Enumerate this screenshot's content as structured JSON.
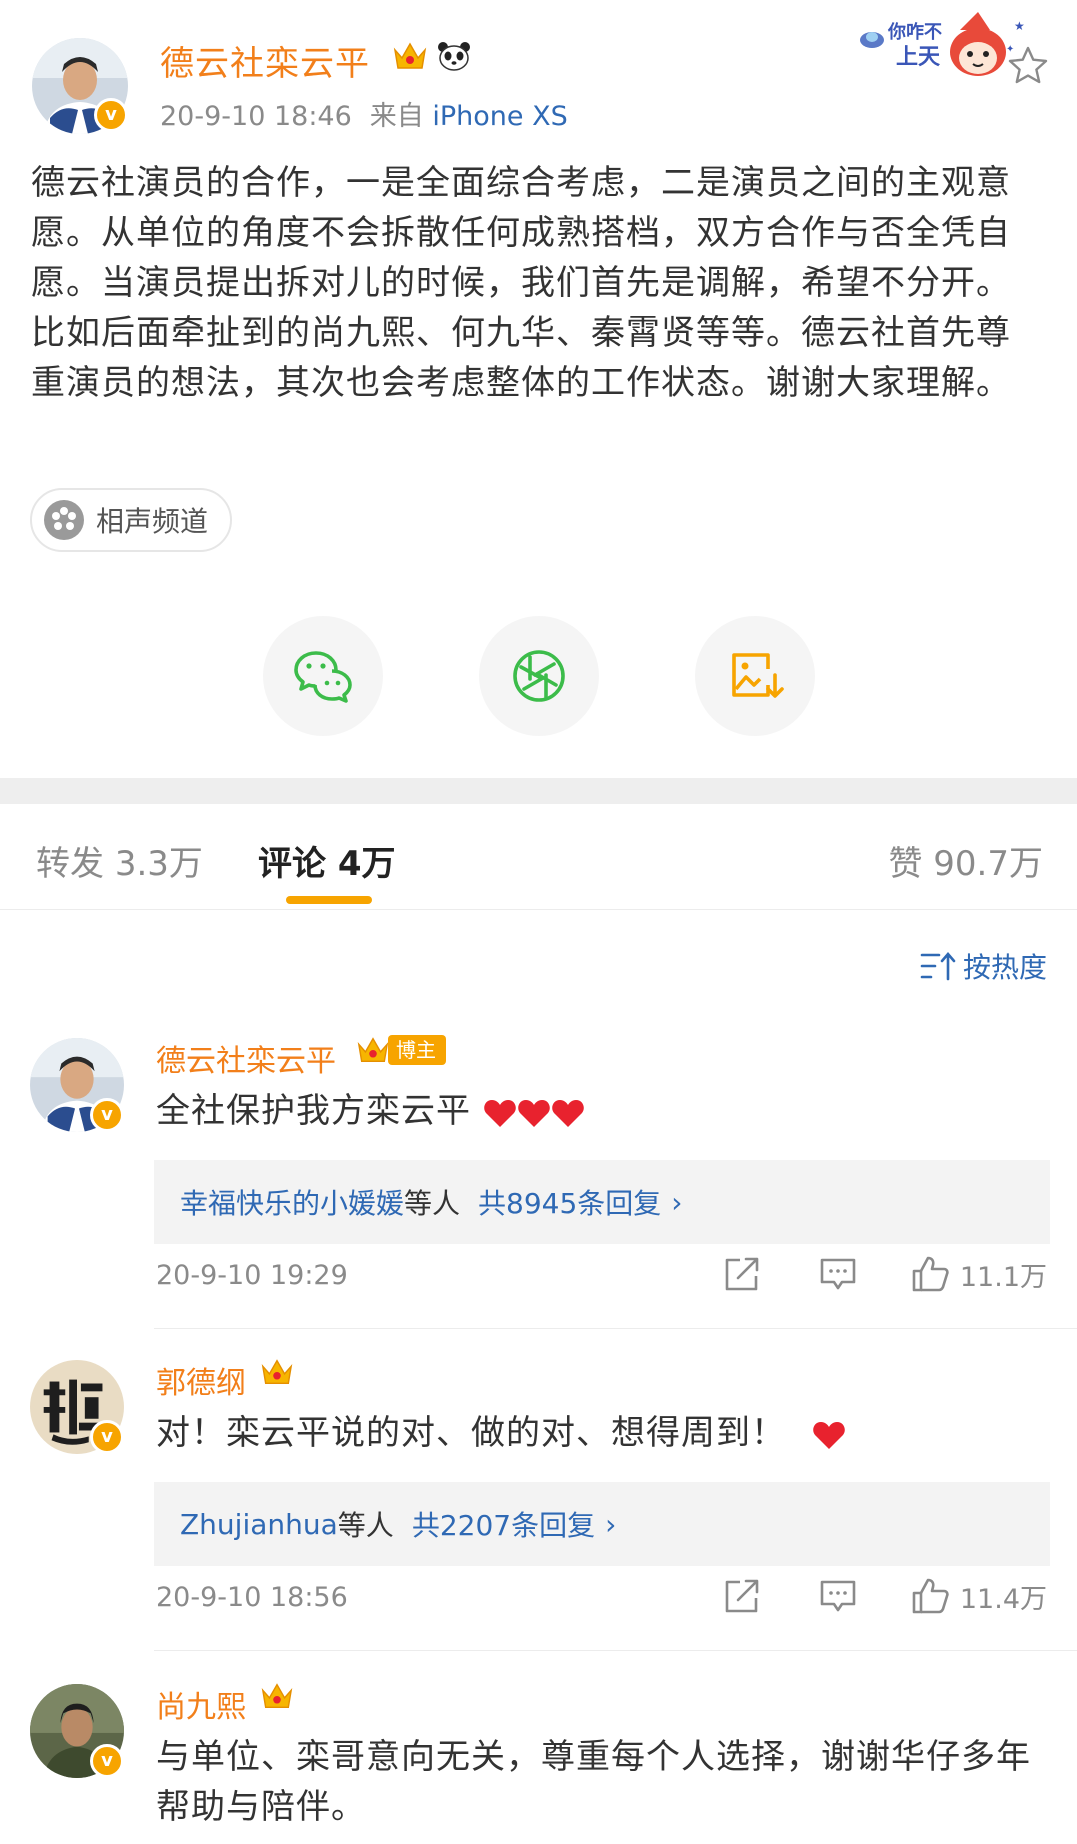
{
  "post": {
    "author": "德云社栾云平",
    "timestamp": "20-9-10 18:46",
    "source_prefix": "来自",
    "device": "iPhone XS",
    "body": "德云社演员的合作，一是全面综合考虑，二是演员之间的主观意愿。从单位的角度不会拆散任何成熟搭档，双方合作与否全凭自愿。当演员提出拆对儿的时候，我们首先是调解，希望不分开。比如后面牵扯到的尚九熙、何九华、秦霄贤等等。德云社首先尊重演员的想法，其次也会考虑整体的工作状态。谢谢大家理解。",
    "topic_label": "相声频道",
    "sticker_text_top": "你咋不",
    "sticker_text_bottom": "上天",
    "share_icons": [
      "wechat-icon",
      "moments-icon",
      "save-image-icon"
    ],
    "verified_mark": "v"
  },
  "tabs": {
    "repost_label": "转发",
    "repost_count": "3.3万",
    "comment_label": "评论",
    "comment_count": "4万",
    "like_label": "赞",
    "like_count": "90.7万"
  },
  "sort": {
    "label": "按热度"
  },
  "comments": [
    {
      "name": "德云社栾云平",
      "badge": "博主",
      "text": "全社保护我方栾云平",
      "reply_users": "幸福快乐的小媛媛",
      "reply_etc": "等人",
      "reply_count": "共8945条回复",
      "time": "20-9-10 19:29",
      "likes": "11.1万"
    },
    {
      "name": "郭德纲",
      "text": "对！栾云平说的对、做的对、想得周到！",
      "reply_users": "Zhujianhua",
      "reply_etc": "等人",
      "reply_count": "共2207条回复",
      "time": "20-9-10 18:56",
      "likes": "11.4万"
    },
    {
      "name": "尚九熙",
      "text": "与单位、栾哥意向无关，尊重每个人选择，谢谢华仔多年帮助与陪伴。"
    }
  ],
  "colors": {
    "name_orange": "#f27f1a",
    "link_blue": "#2f69b4",
    "accent": "#f7a400",
    "heart_red": "#e8222e",
    "wechat_green": "#3cbc4a"
  }
}
